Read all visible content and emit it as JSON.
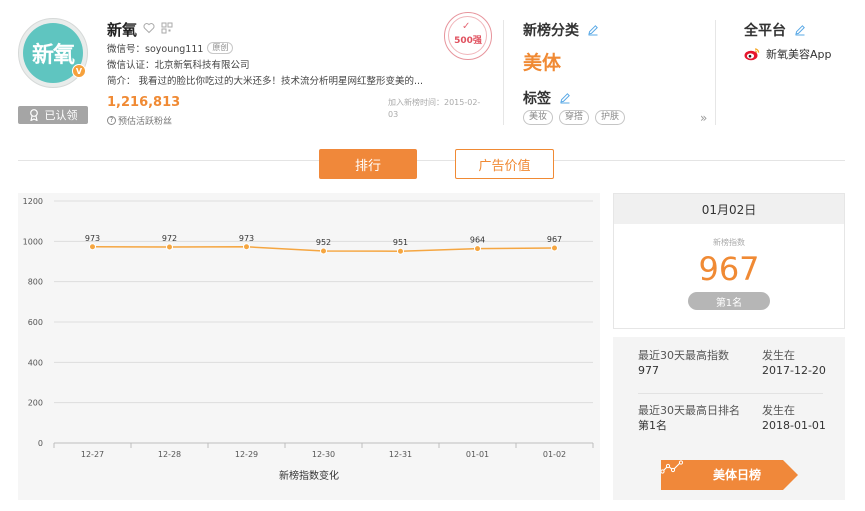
{
  "account": {
    "avatar_text": "新氧",
    "name": "新氧",
    "wechat_id": "微信号：soyoung111",
    "original_tag": "原创",
    "verification": "微信认证：北京新氧科技有限公司",
    "intro": "简介：  我看过的脸比你吃过的大米还多！技术流分析明星网红整形变美的...",
    "fans_count": "1,216,813",
    "fans_label": "预估活跃粉丝",
    "claimed_label": "已认领",
    "join_time": "加入新榜时间：2015-02-03",
    "stamp_text": "500强"
  },
  "category": {
    "title": "新榜分类",
    "value": "美体",
    "tags_title": "标签",
    "tags": [
      "美妆",
      "穿搭",
      "护肤"
    ],
    "more": "»"
  },
  "platform": {
    "title": "全平台",
    "weibo_label": "新氧美容App"
  },
  "tabs": {
    "rank": "排行",
    "ad_value": "广告价值"
  },
  "chart_data": {
    "type": "line",
    "categories": [
      "12-27",
      "12-28",
      "12-29",
      "12-30",
      "12-31",
      "01-01",
      "01-02"
    ],
    "values": [
      973,
      972,
      973,
      952,
      951,
      964,
      967
    ],
    "ylim": [
      0,
      1200
    ],
    "yticks": [
      0,
      200,
      400,
      600,
      800,
      1000,
      1200
    ],
    "xlabel": "新榜指数变化",
    "color": "#f5a641",
    "grid": true
  },
  "date_card": {
    "date": "01月02日",
    "index_label": "新榜指数",
    "index_value": "967",
    "rank": "第1名"
  },
  "stats": {
    "max_index_label": "最近30天最高指数",
    "max_index_value": "977",
    "max_index_when_label": "发生在",
    "max_index_when": "2017-12-20",
    "max_rank_label": "最近30天最高日排名",
    "max_rank_value": "第1名",
    "max_rank_when_label": "发生在",
    "max_rank_when": "2018-01-01"
  },
  "daily_button": {
    "label": "美体日榜"
  },
  "colors": {
    "accent": "#f08a34",
    "avatar_bg": "#5fc5c0"
  }
}
